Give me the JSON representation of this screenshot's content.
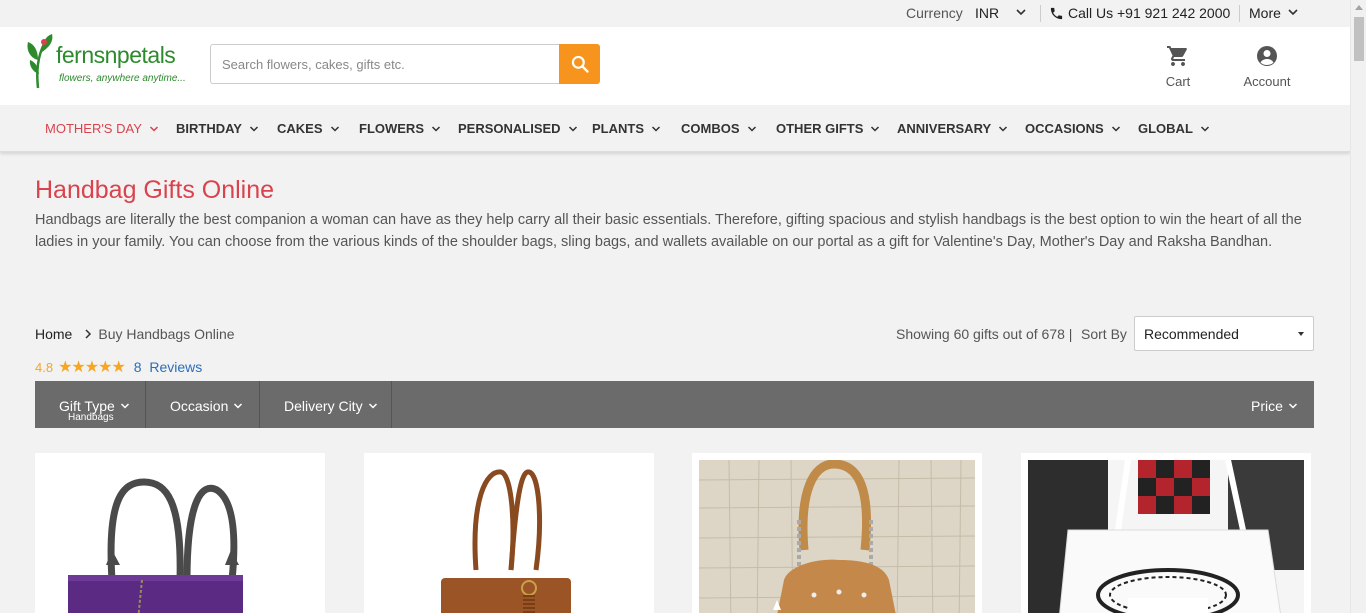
{
  "topbar": {
    "currency_label": "Currency",
    "currency_value": "INR",
    "call_text": "Call Us +91 921 242 2000",
    "more_label": "More"
  },
  "header": {
    "brand": "fernsnpetals",
    "tagline": "flowers, anywhere anytime...",
    "search_placeholder": "Search flowers, cakes, gifts etc.",
    "cart_label": "Cart",
    "account_label": "Account"
  },
  "nav": {
    "items": [
      {
        "label": "MOTHER'S DAY"
      },
      {
        "label": "BIRTHDAY"
      },
      {
        "label": "CAKES"
      },
      {
        "label": "FLOWERS"
      },
      {
        "label": "PERSONALISED"
      },
      {
        "label": "PLANTS"
      },
      {
        "label": "COMBOS"
      },
      {
        "label": "OTHER GIFTS"
      },
      {
        "label": "ANNIVERSARY"
      },
      {
        "label": "OCCASIONS"
      },
      {
        "label": "GLOBAL"
      }
    ]
  },
  "page": {
    "title": "Handbag Gifts Online",
    "description": "Handbags are literally the best companion a woman can have as they help carry all their basic essentials. Therefore, gifting spacious and stylish handbags is the best option to win the heart of all the ladies in your family. You can choose from the various kinds of the shoulder bags, sling bags, and wallets available on our portal as a gift for Valentine's Day, Mother's Day and Raksha Bandhan."
  },
  "breadcrumb": {
    "home": "Home",
    "current": "Buy Handbags Online"
  },
  "rating": {
    "score": "4.8",
    "stars": "★★★★★",
    "review_count": "8",
    "reviews_label": "Reviews"
  },
  "listing": {
    "showing_text": "Showing 60 gifts out of 678 |",
    "sort_label": "Sort By",
    "sort_value": "Recommended"
  },
  "filters": {
    "gift_type": "Gift Type",
    "gift_type_value": "Handbags",
    "occasion": "Occasion",
    "delivery_city": "Delivery City",
    "price": "Price"
  },
  "products": [
    {
      "image": "purple-handbag"
    },
    {
      "image": "brown-fringe-handbag"
    },
    {
      "image": "tan-chain-handbag"
    },
    {
      "image": "white-tote-bag"
    }
  ],
  "colors": {
    "accent": "#d9434e",
    "search_button": "#f7941d",
    "brand_green": "#2d8a2d",
    "filter_bar": "#6b6b6b",
    "star": "#f5a623",
    "link": "#2a6ebb"
  }
}
